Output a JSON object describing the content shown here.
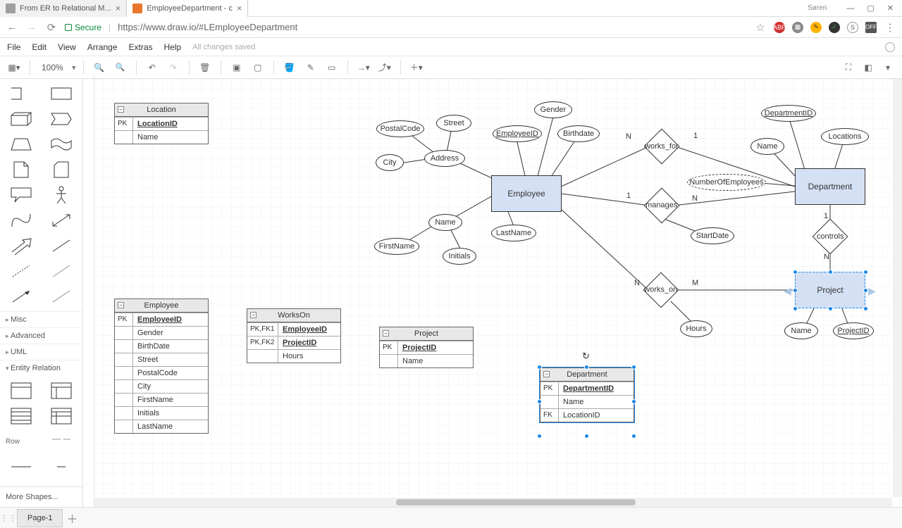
{
  "browser": {
    "tabs": [
      {
        "title": "From ER to Relational M...",
        "active": false
      },
      {
        "title": "EmployeeDepartment - c",
        "active": true
      }
    ],
    "user": "Søren",
    "secure_label": "Secure",
    "url": "https://www.draw.io/#LEmployeeDepartment"
  },
  "menu": {
    "items": [
      "File",
      "Edit",
      "View",
      "Arrange",
      "Extras",
      "Help"
    ],
    "status": "All changes saved"
  },
  "toolbar": {
    "zoom": "100%"
  },
  "sidebar": {
    "categories": [
      "Misc",
      "Advanced",
      "UML",
      "Entity Relation"
    ],
    "row_label": "Row",
    "more": "More Shapes..."
  },
  "tables": {
    "location": {
      "title": "Location",
      "rows": [
        {
          "k": "PK",
          "v": "LocationID",
          "pk": true
        },
        {
          "k": "",
          "v": "Name"
        }
      ]
    },
    "employee": {
      "title": "Employee",
      "rows": [
        {
          "k": "PK",
          "v": "EmployeeID",
          "pk": true
        },
        {
          "k": "",
          "v": "Gender"
        },
        {
          "k": "",
          "v": "BirthDate"
        },
        {
          "k": "",
          "v": "Street"
        },
        {
          "k": "",
          "v": "PostalCode"
        },
        {
          "k": "",
          "v": "City"
        },
        {
          "k": "",
          "v": "FirstName"
        },
        {
          "k": "",
          "v": "Initials"
        },
        {
          "k": "",
          "v": "LastName"
        }
      ]
    },
    "workson": {
      "title": "WorksOn",
      "rows": [
        {
          "k": "PK,FK1",
          "v": "EmployeeID",
          "pk": true
        },
        {
          "k": "PK,FK2",
          "v": "ProjectID",
          "pk": true
        },
        {
          "k": "",
          "v": "Hours"
        }
      ]
    },
    "project": {
      "title": "Project",
      "rows": [
        {
          "k": "PK",
          "v": "ProjectID",
          "pk": true
        },
        {
          "k": "",
          "v": "Name"
        }
      ]
    },
    "department": {
      "title": "Department",
      "rows": [
        {
          "k": "PK",
          "v": "DepartmentID",
          "pk": true
        },
        {
          "k": "",
          "v": "Name"
        },
        {
          "k": "FK",
          "v": "LocationID"
        }
      ]
    }
  },
  "er": {
    "entities": {
      "employee": "Employee",
      "department": "Department",
      "project": "Project"
    },
    "attrs": {
      "postalcode": "PostalCode",
      "street": "Street",
      "city": "City",
      "address": "Address",
      "employeeid": "EmployeeID",
      "gender": "Gender",
      "birthdate": "Birthdate",
      "name_emp": "Name",
      "firstname": "FirstName",
      "lastname": "LastName",
      "initials": "Initials",
      "departmentid": "DepartmentID",
      "name_dep": "Name",
      "locations": "Locations",
      "numemp": "NumberOfEmployees",
      "startdate": "StartDate",
      "hours": "Hours",
      "name_proj": "Name",
      "projectid": "ProjectID"
    },
    "rels": {
      "works_for": "works_for",
      "manages": "manages",
      "controls": "controls",
      "works_on": "works_on"
    },
    "card": {
      "wf1": "N",
      "wf2": "1",
      "mg1": "1",
      "mg2": "N",
      "ct1": "1",
      "ct2": "N",
      "wo1": "N",
      "wo2": "M"
    }
  },
  "page_tab": "Page-1"
}
